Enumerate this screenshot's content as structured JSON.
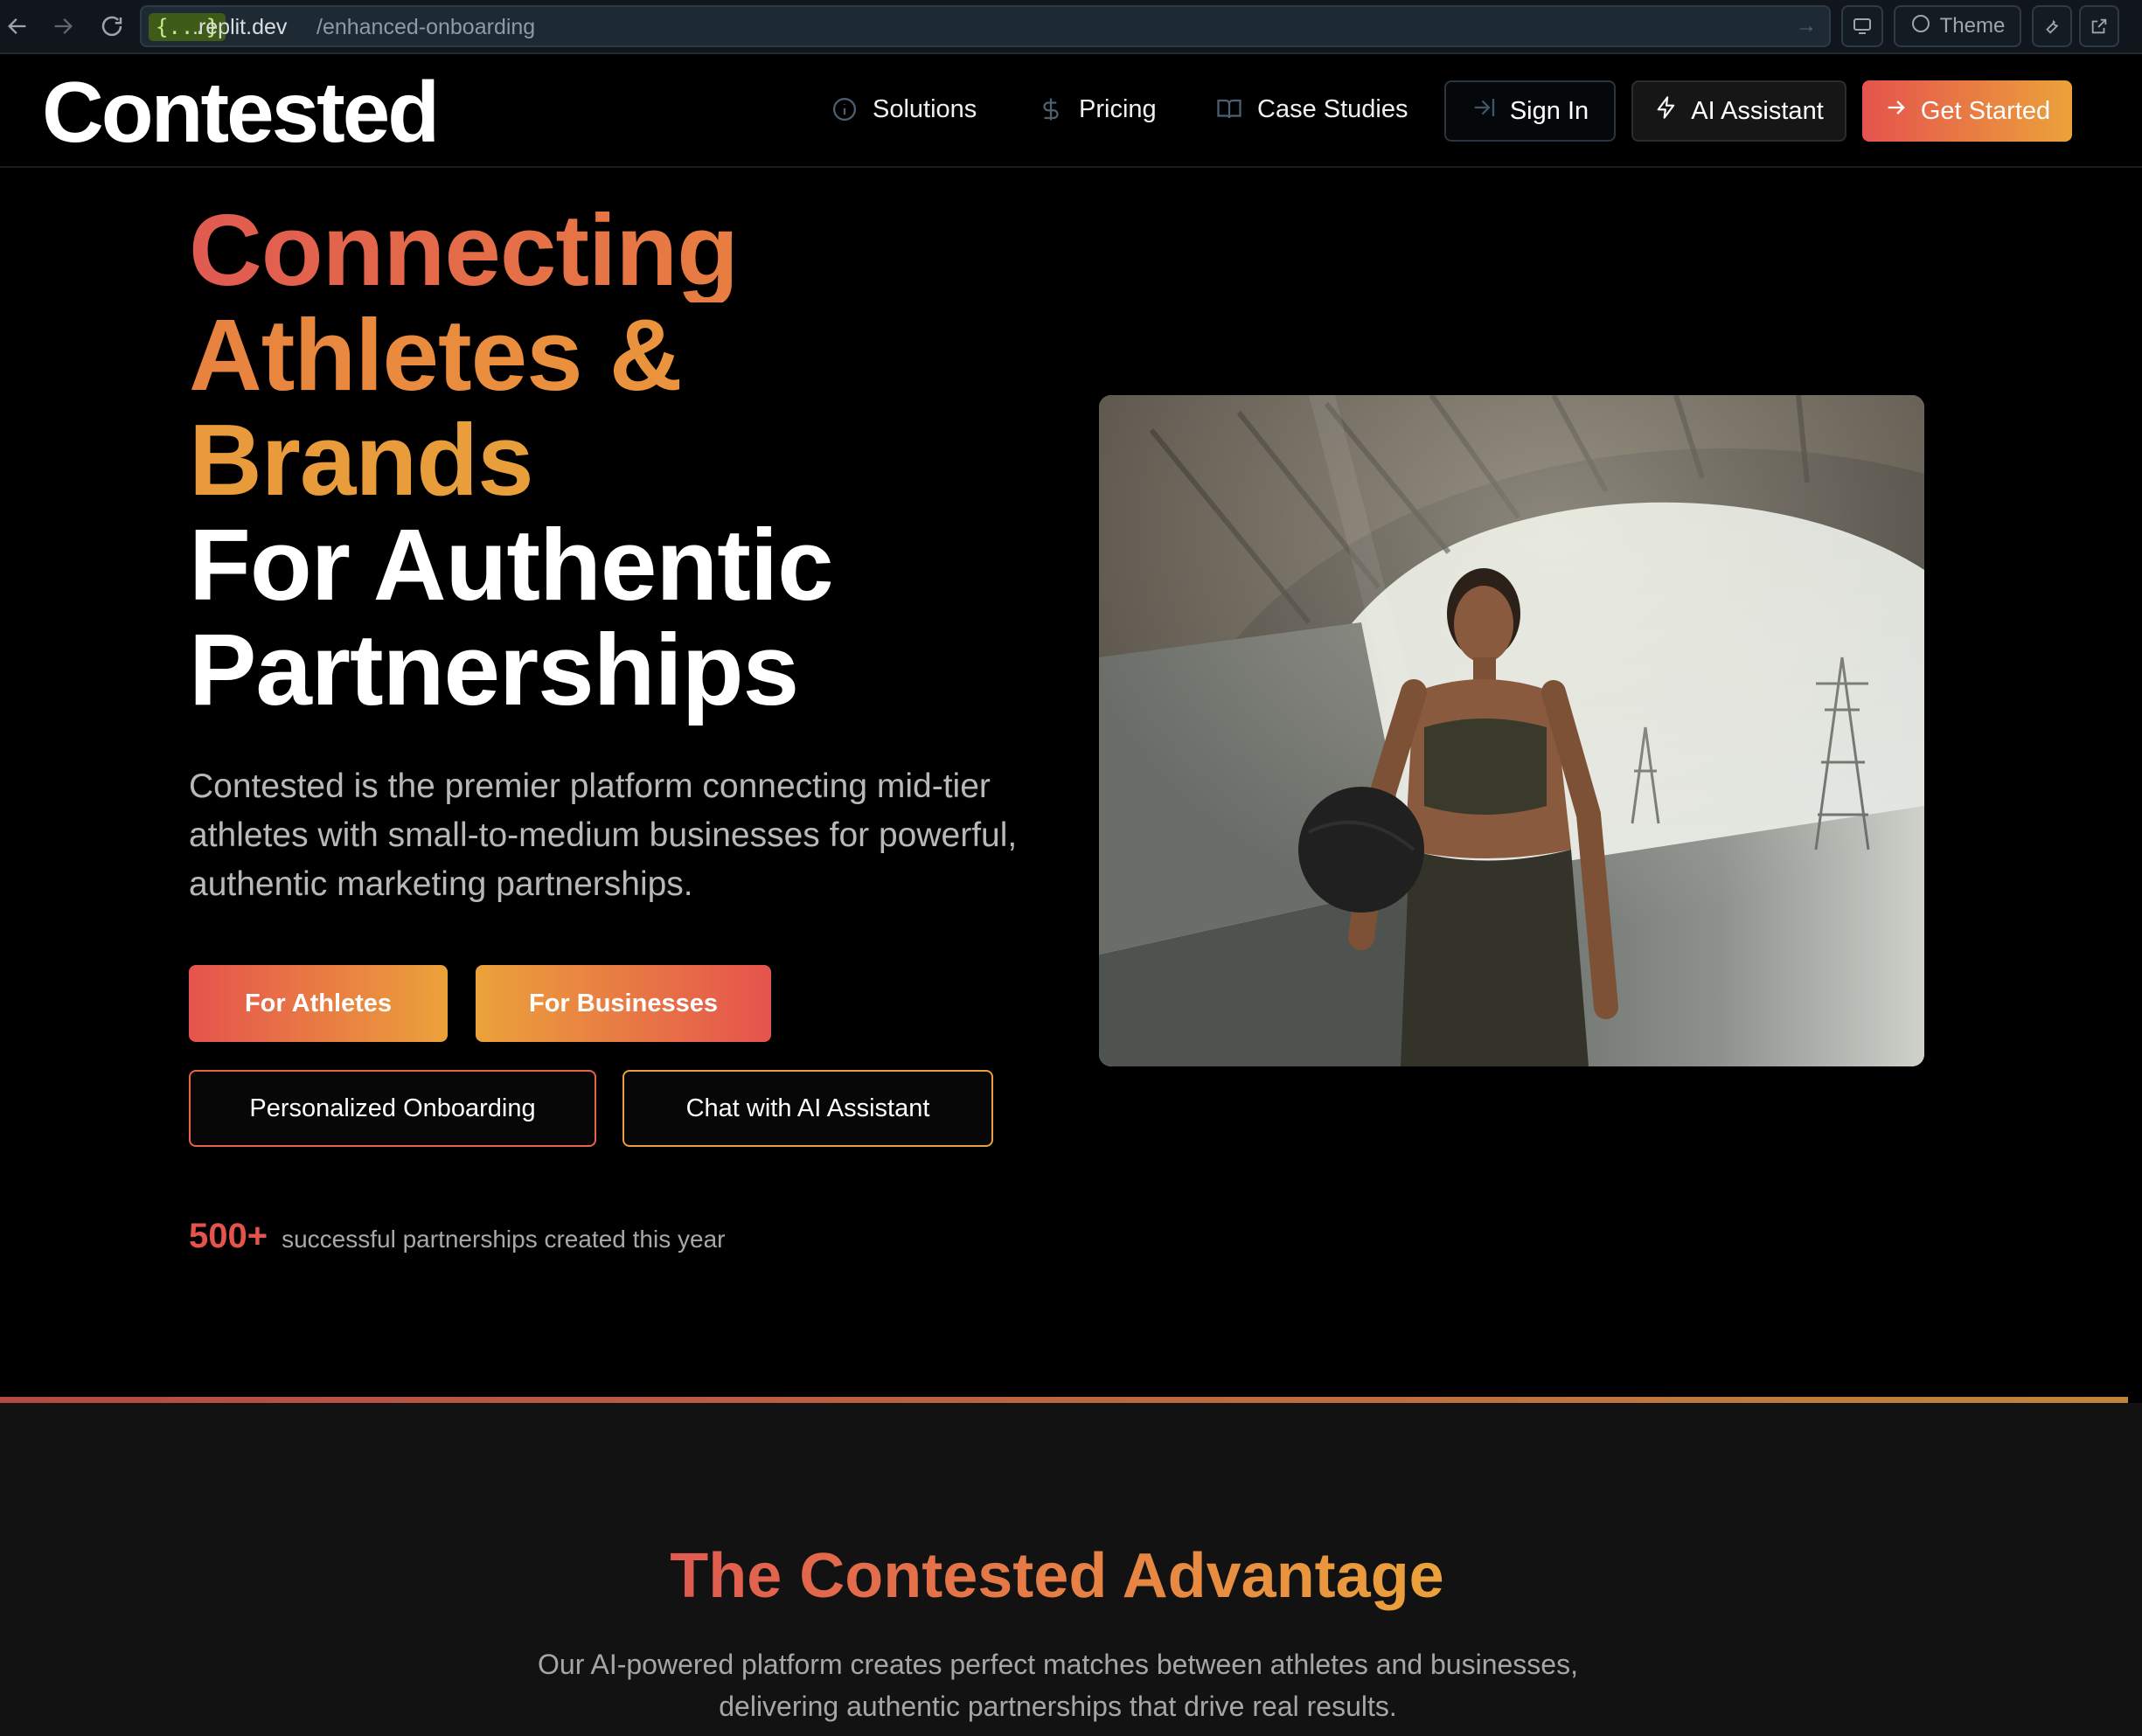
{
  "browser": {
    "url_badge": "{...}",
    "url_host": ".replit.dev",
    "url_path": "/enhanced-onboarding",
    "theme_label": "Theme"
  },
  "nav": {
    "logo": "Contested",
    "links": [
      {
        "label": "Solutions",
        "icon": "info-icon"
      },
      {
        "label": "Pricing",
        "icon": "dollar-icon"
      },
      {
        "label": "Case Studies",
        "icon": "book-icon"
      }
    ],
    "sign_in": "Sign In",
    "ai_assistant": "AI Assistant",
    "get_started": "Get Started"
  },
  "hero": {
    "title_line1": "Connecting",
    "title_line2": "Athletes &",
    "title_line3": "Brands",
    "title_line4": "For Authentic",
    "title_line5": "Partnerships",
    "description": "Contested is the premier platform connecting mid-tier athletes with small-to-medium businesses for powerful, authentic marketing partnerships.",
    "cta_athletes": "For Athletes",
    "cta_businesses": "For Businesses",
    "cta_onboarding": "Personalized Onboarding",
    "cta_chat": "Chat with AI Assistant",
    "stat_number": "500+",
    "stat_text": "successful partnerships created this year"
  },
  "advantage": {
    "title": "The Contested Advantage",
    "description": "Our AI-powered platform creates perfect matches between athletes and businesses, delivering authentic partnerships that drive real results."
  },
  "colors": {
    "accent_red": "#e5534d",
    "accent_orange": "#eba23a",
    "background": "#000000"
  }
}
